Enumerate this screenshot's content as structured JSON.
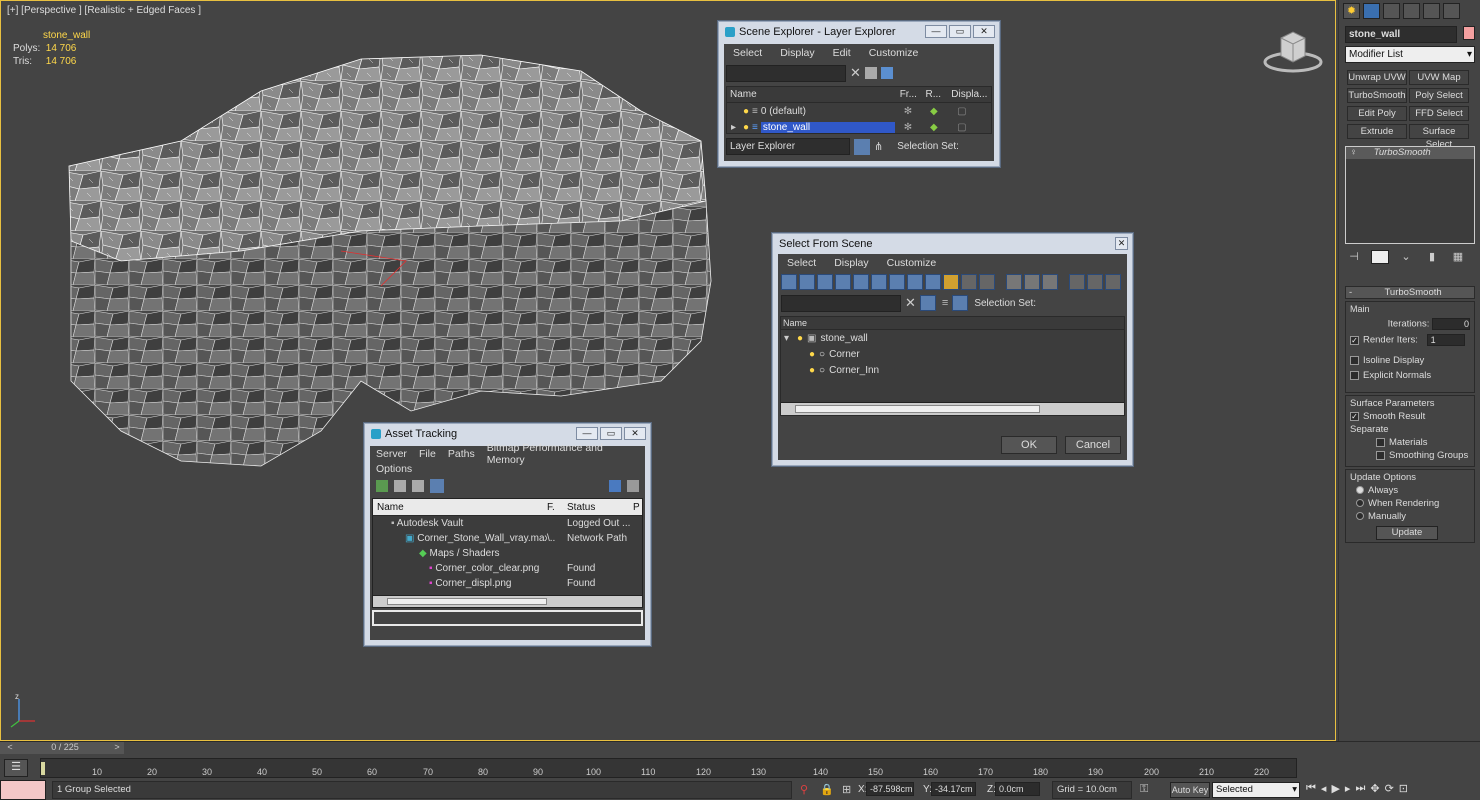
{
  "viewport": {
    "label": "[+] [Perspective ] [Realistic + Edged Faces ]",
    "object_name": "stone_wall",
    "polys_label": "Polys:",
    "polys_value": "14 706",
    "tris_label": "Tris:",
    "tris_value": "14 706"
  },
  "layer_explorer": {
    "title": "Scene Explorer - Layer Explorer",
    "menu": [
      "Select",
      "Display",
      "Edit",
      "Customize"
    ],
    "columns": [
      "Name",
      "Fr...",
      "R...",
      "Displa..."
    ],
    "rows": [
      "0 (default)",
      "stone_wall"
    ],
    "footer_dropdown": "Layer Explorer",
    "selection_set_label": "Selection Set:"
  },
  "select_from_scene": {
    "title": "Select From Scene",
    "menu": [
      "Select",
      "Display",
      "Customize"
    ],
    "selection_set_label": "Selection Set:",
    "column_name": "Name",
    "tree": [
      "stone_wall",
      "Corner",
      "Corner_Inn"
    ],
    "ok": "OK",
    "cancel": "Cancel"
  },
  "asset_tracking": {
    "title": "Asset Tracking",
    "menu": [
      "Server",
      "File",
      "Paths",
      "Bitmap Performance and Memory"
    ],
    "menu2": "Options",
    "columns": [
      "Name",
      "F.",
      "Status",
      "P"
    ],
    "rows": [
      {
        "name": "Autodesk Vault",
        "f": "",
        "status": "Logged Out ..."
      },
      {
        "name": "Corner_Stone_Wall_vray.max",
        "f": "\\..",
        "status": "Network Path"
      },
      {
        "name": "Maps / Shaders",
        "f": "",
        "status": ""
      },
      {
        "name": "Corner_color_clear.png",
        "f": "",
        "status": "Found"
      },
      {
        "name": "Corner_displ.png",
        "f": "",
        "status": "Found"
      }
    ]
  },
  "command_panel": {
    "object_name": "stone_wall",
    "modifier_list": "Modifier List",
    "buttons": [
      "Unwrap UVW",
      "UVW Map",
      "TurboSmooth",
      "Poly Select",
      "Edit Poly",
      "FFD Select",
      "Extrude",
      "Surface Select"
    ],
    "stack_item": "TurboSmooth",
    "rollout_title": "TurboSmooth",
    "main_label": "Main",
    "iterations_label": "Iterations:",
    "iterations_value": "0",
    "render_iters_label": "Render Iters:",
    "render_iters_value": "1",
    "isoline_display": "Isoline Display",
    "explicit_normals": "Explicit Normals",
    "surface_params": "Surface Parameters",
    "smooth_result": "Smooth Result",
    "separate": "Separate",
    "materials": "Materials",
    "smoothing_groups": "Smoothing Groups",
    "update_options": "Update Options",
    "always": "Always",
    "when_rendering": "When Rendering",
    "manually": "Manually",
    "update_btn": "Update"
  },
  "timeline": {
    "frame_counter": "0 / 225",
    "ticks": [
      "10",
      "20",
      "30",
      "40",
      "50",
      "60",
      "70",
      "80",
      "90",
      "100",
      "110",
      "120",
      "130",
      "140",
      "150",
      "160",
      "170",
      "180",
      "190",
      "200",
      "210",
      "220"
    ],
    "status": "1 Group Selected",
    "x_label": "X:",
    "x_value": "-87.598cm",
    "y_label": "Y:",
    "y_value": "-34.17cm",
    "z_label": "Z:",
    "z_value": "0.0cm",
    "grid": "Grid = 10.0cm",
    "auto_key": "Auto Key",
    "selected": "Selected"
  }
}
